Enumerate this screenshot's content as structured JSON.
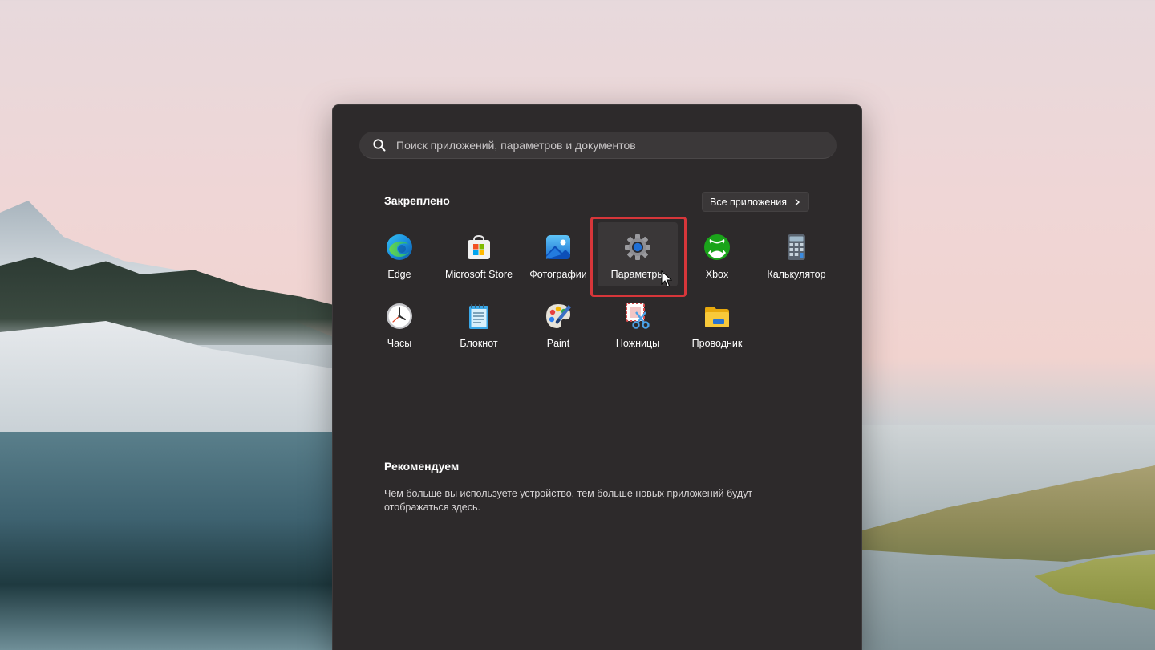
{
  "search": {
    "placeholder": "Поиск приложений, параметров и документов"
  },
  "pinned": {
    "title": "Закреплено",
    "all_apps_label": "Все приложения",
    "apps": [
      {
        "label": "Edge",
        "icon": "edge-icon"
      },
      {
        "label": "Microsoft Store",
        "icon": "store-icon"
      },
      {
        "label": "Фотографии",
        "icon": "photos-icon"
      },
      {
        "label": "Параметры",
        "icon": "settings-gear-icon"
      },
      {
        "label": "Xbox",
        "icon": "xbox-icon"
      },
      {
        "label": "Калькулятор",
        "icon": "calculator-icon"
      },
      {
        "label": "Часы",
        "icon": "clock-icon"
      },
      {
        "label": "Блокнот",
        "icon": "notepad-icon"
      },
      {
        "label": "Paint",
        "icon": "paint-icon"
      },
      {
        "label": "Ножницы",
        "icon": "snipping-tool-icon"
      },
      {
        "label": "Проводник",
        "icon": "file-explorer-icon"
      }
    ]
  },
  "recommended": {
    "title": "Рекомендуем",
    "text": "Чем больше вы используете устройство, тем больше новых приложений будут отображаться здесь."
  },
  "colors": {
    "menu_bg": "#2d2a2b",
    "highlight": "#d7363a",
    "text": "#ffffff"
  }
}
